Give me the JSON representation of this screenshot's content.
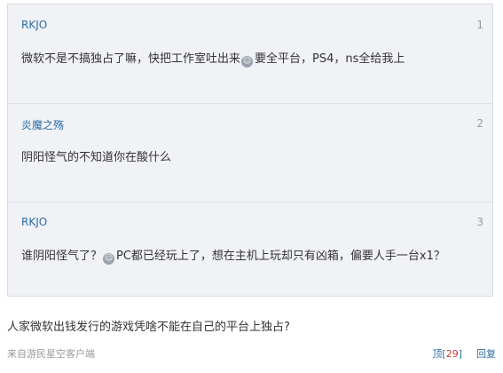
{
  "quotes": [
    {
      "user": "RKJO",
      "floor": "1",
      "text_before": "微软不是不搞独占了嘛，快把工作室吐出来",
      "text_after": "要全平台，PS4，ns全给我上"
    },
    {
      "user": "炎魔之殇",
      "floor": "2",
      "text": "阴阳怪气的不知道你在酸什么"
    },
    {
      "user": "RKJO",
      "floor": "3",
      "text_before": "谁阴阳怪气了？",
      "text_after": "PC都已经玩上了，想在主机上玩却只有凶箱，偏要人手一台x1？"
    }
  ],
  "reply": {
    "text": "人家微软出钱发行的游戏凭啥不能在自己的平台上独占?",
    "source": "来自游民星空客户端",
    "like_label": "顶",
    "like_count": "29",
    "reply_label": "回复"
  },
  "colors": {
    "username": "#2b6ca3",
    "count": "#d13a3a"
  },
  "icons": [
    "emoji-icon"
  ]
}
